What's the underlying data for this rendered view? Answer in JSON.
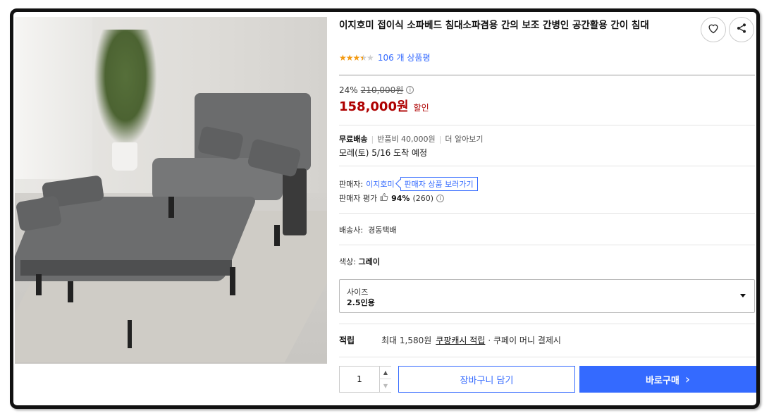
{
  "product": {
    "title": "이지호미 접이식 소파베드 침대소파겸용 간의 보조 간병인 공간활용 간이 침대",
    "rating_stars": 3.5,
    "review_count_text": "106 개 상품평",
    "image_alt": "회색 접이식 소파베드"
  },
  "icons": {
    "wish": "heart-icon",
    "share": "share-icon",
    "info": "info-icon",
    "thumb": "thumbs-up-icon",
    "caret": "caret-down-icon",
    "chevron": "chevron-right-icon"
  },
  "price": {
    "discount_percent": "24%",
    "original_price": "210,000원",
    "sale_price": "158,000원",
    "sale_tag": "할인"
  },
  "shipping": {
    "free_label": "무료배송",
    "return_fee": "반품비 40,000원",
    "more_link": "더 알아보기",
    "arrival": "모레(토) 5/16 도착 예정"
  },
  "seller": {
    "label": "판매자:",
    "name": "이지호미",
    "tooltip": "판매자 상품 보러가기",
    "rating_label": "판매자 평가",
    "rating_percent": "94%",
    "rating_count": "(260)"
  },
  "carrier": {
    "label": "배송사:",
    "value": "경동택배"
  },
  "color": {
    "label": "색상:",
    "value": "그레이"
  },
  "size": {
    "label": "사이즈",
    "value": "2.5인용"
  },
  "reward": {
    "label": "적립",
    "text": "최대 1,580원",
    "link": "쿠팡캐시 적립",
    "extra": "· 쿠페이 머니 결제시"
  },
  "actions": {
    "quantity": "1",
    "cart_label": "장바구니 담기",
    "buy_label": "바로구매",
    "buy_chevron": "›"
  },
  "colors": {
    "accent": "#346aff",
    "price_red": "#ae0000",
    "star": "#f39a12"
  }
}
